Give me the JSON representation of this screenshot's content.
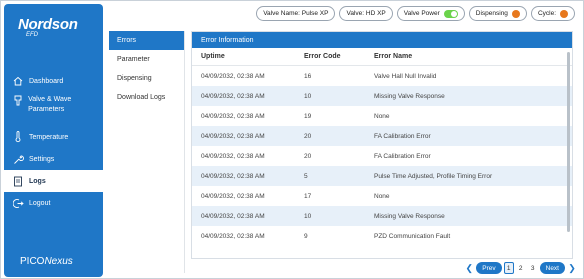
{
  "logo": {
    "brand": "Nordson",
    "sub": "EFD"
  },
  "nav": [
    {
      "name": "nav-dashboard",
      "icon": "home-icon",
      "label": "Dashboard"
    },
    {
      "name": "nav-valve-wave-parameters",
      "icon": "valve-icon",
      "label": "Valve & Wave Parameters"
    },
    {
      "name": "nav-temperature",
      "icon": "thermometer-icon",
      "label": "Temperature"
    },
    {
      "name": "nav-settings",
      "icon": "wrench-icon",
      "label": "Settings"
    },
    {
      "name": "nav-logs",
      "icon": "log-icon",
      "label": "Logs"
    },
    {
      "name": "nav-logout",
      "icon": "logout-icon",
      "label": "Logout"
    }
  ],
  "brand_bottom": {
    "prefix": "PICO",
    "suffix": "Nexus"
  },
  "topbar": {
    "valve_name": "Valve Name: Pulse XP",
    "valve": "Valve: HD XP",
    "valve_power": "Valve Power",
    "dispensing": "Dispensing",
    "cycle": "Cycle:"
  },
  "status_colors": {
    "power_on": "#6bd34b",
    "dispensing": "#e7781d",
    "cycle": "#e7781d"
  },
  "submenu": [
    "Errors",
    "Parameter",
    "Dispensing",
    "Download Logs"
  ],
  "table": {
    "title": "Error Information",
    "columns": [
      "Uptime",
      "Error Code",
      "Error Name"
    ],
    "rows": [
      [
        "04/09/2032, 02:38 AM",
        "16",
        "Valve Hall Null Invalid"
      ],
      [
        "04/09/2032, 02:38 AM",
        "10",
        "Missing Valve Response"
      ],
      [
        "04/09/2032, 02:38 AM",
        "19",
        "None"
      ],
      [
        "04/09/2032, 02:38 AM",
        "20",
        "FA Calibration Error"
      ],
      [
        "04/09/2032, 02:38 AM",
        "20",
        "FA Calibration Error"
      ],
      [
        "04/09/2032, 02:38 AM",
        "5",
        "Pulse Time Adjusted, Profile Timing Error"
      ],
      [
        "04/09/2032, 02:38 AM",
        "17",
        "None"
      ],
      [
        "04/09/2032, 02:38 AM",
        "10",
        "Missing Valve Response"
      ],
      [
        "04/09/2032, 02:38 AM",
        "9",
        "PZD Communication Fault"
      ]
    ]
  },
  "pager": {
    "prev": "Prev",
    "next": "Next",
    "pages": [
      "1",
      "2",
      "3"
    ],
    "current": "1"
  }
}
